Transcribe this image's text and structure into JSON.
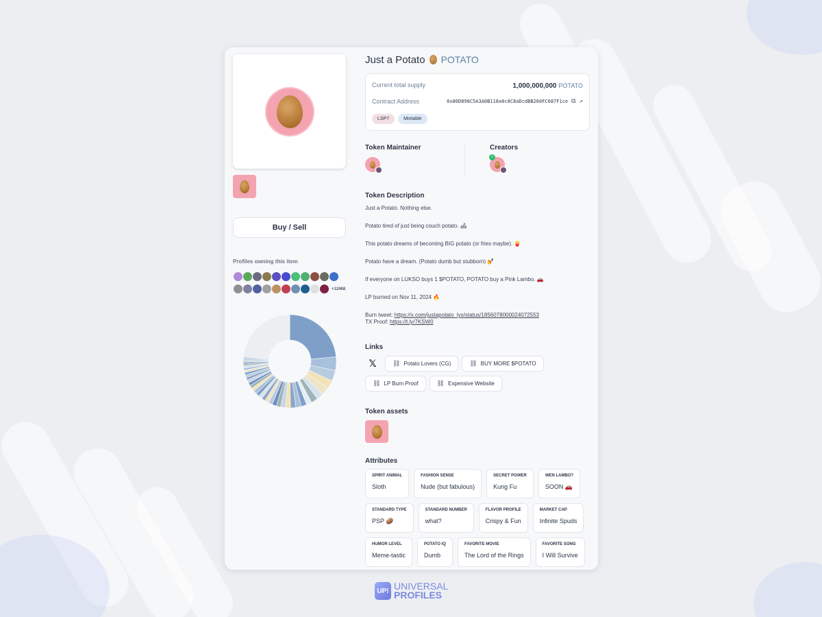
{
  "token": {
    "name": "Just a Potato",
    "symbol": "POTATO",
    "supply_label": "Current total supply",
    "supply_value": "1,000,000,000",
    "supply_symbol": "POTATO",
    "contract_label": "Contract Address",
    "contract_address": "0x80D898C5A3A0B118a0c8C8aDcdBB260FC687F1ce",
    "badges": [
      "LSP7",
      "Mintable"
    ]
  },
  "left": {
    "buy_label": "Buy / Sell",
    "owners_label": "Profiles owning this item",
    "owners_more": "+12468"
  },
  "people": {
    "maintainer_label": "Token Maintainer",
    "creators_label": "Creators"
  },
  "description": {
    "title": "Token Description",
    "paragraphs": [
      "Just a Potato. Nothing else.",
      "Potato tired of just being couch potato. 🛋",
      "This potato dreams of becoming BIG potato (or fries maybe). 🍟",
      "Potato have a dream. (Potato dumb but stubborn) 💅",
      "If everyone on LUKSO buys 1 $POTATO, POTATO buy a Pink Lambo. 🚗",
      "LP burned on Nov 11, 2024 🔥"
    ],
    "burn_tweet_label": "Burn tweet:",
    "burn_tweet_url": "https://x.com/justapotato_lyx/status/1856078000024072553",
    "tx_proof_label": "TX Proof:",
    "tx_proof_url": "https://t.ly/7KSW0"
  },
  "links": {
    "title": "Links",
    "x_icon": "x-logo-icon",
    "items": [
      "Potato Lovers (CG)",
      "BUY MORE $POTATO",
      "LP Burn Proof",
      "Expensive Website"
    ]
  },
  "assets": {
    "title": "Token assets"
  },
  "attributes": {
    "title": "Attributes",
    "rows": [
      [
        {
          "key": "SPIRIT ANIMAL",
          "value": "Sloth"
        },
        {
          "key": "FASHION SENSE",
          "value": "Nude (but fabulous)"
        },
        {
          "key": "SECRET POWER",
          "value": "Kung Fu"
        },
        {
          "key": "WEN LAMBO?",
          "value": "SOON 🚗"
        }
      ],
      [
        {
          "key": "STANDARD TYPE",
          "value": "PSP 🥔"
        },
        {
          "key": "STANDARD NUMBER",
          "value": "what?"
        },
        {
          "key": "FLAVOR PROFILE",
          "value": "Crispy & Fun"
        },
        {
          "key": "MARKET CAP",
          "value": "Infinite Spuds"
        }
      ],
      [
        {
          "key": "HUMOR LEVEL",
          "value": "Meme-tastic"
        },
        {
          "key": "POTATO IQ",
          "value": "Dumb"
        },
        {
          "key": "FAVORITE MOVIE",
          "value": "The Lord of the Rings"
        },
        {
          "key": "FAVORITE SONG",
          "value": "I Will Survive"
        }
      ]
    ]
  },
  "footer": {
    "logo_mark": "UP!",
    "line1": "UNIVERSAL",
    "line2": "PROFILES"
  },
  "colors": {
    "accent": "#5a7fa5",
    "potato_bg": "#f4a3b1",
    "logo": "#7d89e0"
  },
  "owner_avatar_colors": [
    "#b089d8",
    "#5aa85a",
    "#6a6a80",
    "#8a7a50",
    "#5a50c0",
    "#4a4ad0",
    "#4ac07a",
    "#50b070",
    "#8a5040",
    "#6a6a60",
    "#3a70c8",
    "#909090",
    "#8080a0",
    "#5060a0",
    "#a0a0a0",
    "#c09060",
    "#c04050",
    "#7090b0",
    "#206090",
    "#e0e0e0",
    "#802040"
  ],
  "holder_chart": {
    "type": "pie",
    "segments": [
      {
        "value": 25,
        "color": "#7e9fc8"
      },
      {
        "value": 5,
        "color": "#a7c0dc"
      },
      {
        "value": 4,
        "color": "#b8ccdf"
      },
      {
        "value": 3,
        "color": "#f3e2b6"
      },
      {
        "value": 3,
        "color": "#f0e4c6"
      },
      {
        "value": 2.5,
        "color": "#d8e2ec"
      },
      {
        "value": 2.5,
        "color": "#9fb4b8"
      },
      {
        "value": 2,
        "color": "#e6eef5"
      },
      {
        "value": 2,
        "color": "#7e9fc8"
      },
      {
        "value": 2,
        "color": "#a7c0dc"
      },
      {
        "value": 2,
        "color": "#8ea6c6"
      },
      {
        "value": 1.8,
        "color": "#f3e2b6"
      },
      {
        "value": 1.8,
        "color": "#c8d6e4"
      },
      {
        "value": 1.6,
        "color": "#9fb4b8"
      },
      {
        "value": 1.6,
        "color": "#6f8fbf"
      },
      {
        "value": 1.5,
        "color": "#b8ccdf"
      },
      {
        "value": 1.5,
        "color": "#f0e4c6"
      },
      {
        "value": 1.4,
        "color": "#8ea6c6"
      },
      {
        "value": 1.4,
        "color": "#d8e2ec"
      },
      {
        "value": 1.3,
        "color": "#7e9fc8"
      },
      {
        "value": 1.3,
        "color": "#a7c0dc"
      },
      {
        "value": 1.2,
        "color": "#f3e2b6"
      },
      {
        "value": 1.2,
        "color": "#9fb4b8"
      },
      {
        "value": 1.1,
        "color": "#6f8fbf"
      },
      {
        "value": 1.1,
        "color": "#c8d6e4"
      },
      {
        "value": 1.0,
        "color": "#8ea6c6"
      },
      {
        "value": 1.0,
        "color": "#b8ccdf"
      },
      {
        "value": 0.9,
        "color": "#7e9fc8"
      },
      {
        "value": 0.9,
        "color": "#f0e4c6"
      },
      {
        "value": 0.8,
        "color": "#a7c0dc"
      },
      {
        "value": 0.8,
        "color": "#d8e2ec"
      },
      {
        "value": 0.7,
        "color": "#9fb4b8"
      },
      {
        "value": 0.7,
        "color": "#8ea6c6"
      },
      {
        "value": 0.6,
        "color": "#c8d6e4"
      },
      {
        "value": 0.6,
        "color": "#b8ccdf"
      },
      {
        "value": 0.5,
        "color": "#a7c0dc"
      },
      {
        "value": 0.5,
        "color": "#d8e2ec"
      },
      {
        "value": 24.7,
        "color": "#eceef2"
      }
    ]
  }
}
